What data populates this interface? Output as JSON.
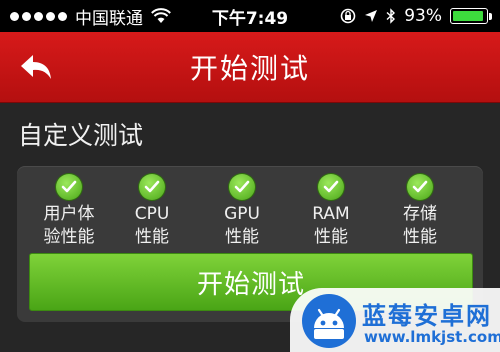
{
  "status_bar": {
    "carrier": "中国联通",
    "time": "下午7:49",
    "battery": "93%",
    "battery_level": 0.93,
    "signal_dots": 5
  },
  "header": {
    "title": "开始测试",
    "back_icon": "back-arrow-icon"
  },
  "section": {
    "title": "自定义测试"
  },
  "tests": [
    {
      "label": "用户体\n验性能",
      "checked": true
    },
    {
      "label": "CPU\n性能",
      "checked": true
    },
    {
      "label": "GPU\n性能",
      "checked": true
    },
    {
      "label": "RAM\n性能",
      "checked": true
    },
    {
      "label": "存储\n性能",
      "checked": true
    }
  ],
  "start_button": {
    "label": "开始测试"
  },
  "watermark": {
    "name": "蓝莓安卓网",
    "url": "www.lmkjst.com"
  },
  "colors": {
    "header_red": "#c81414",
    "button_green": "#66bf2a",
    "check_green": "#5cb82a",
    "brand_blue": "#1f6fd6"
  }
}
